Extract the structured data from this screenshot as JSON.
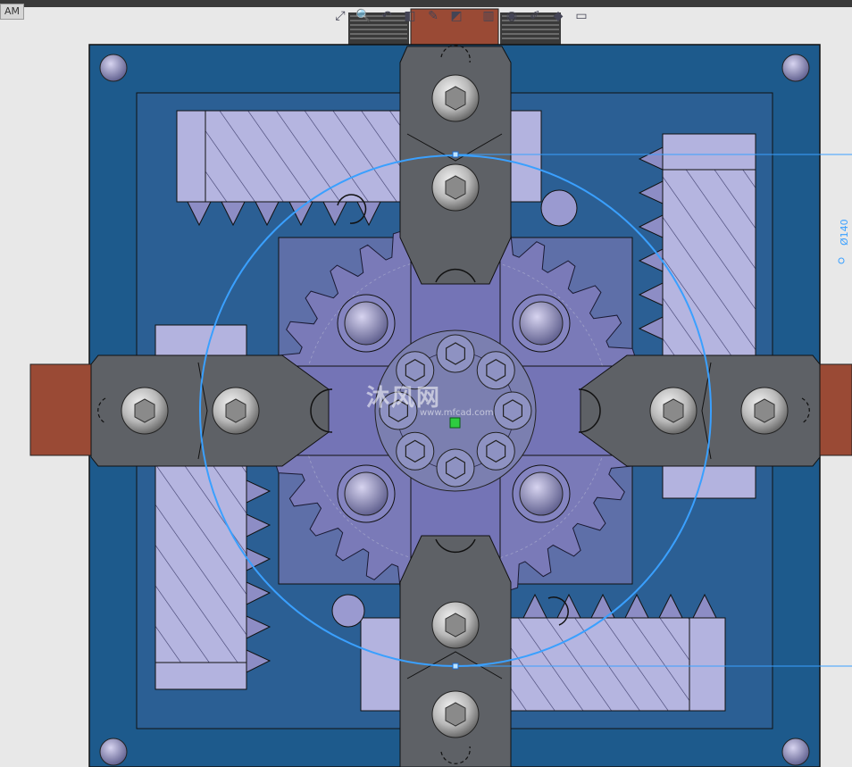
{
  "window": {
    "tab_label": "AM"
  },
  "toolbar": {
    "icons": [
      "zoom-fit-icon",
      "zoom-area-icon",
      "previous-view-icon",
      "section-view-icon",
      "dynamic-annotation-icon",
      "view-orientation-icon",
      "display-style-icon",
      "hide-show-icon",
      "edit-appearance-icon",
      "apply-scene-icon",
      "view-settings-icon"
    ]
  },
  "watermark": {
    "text": "沐风网",
    "sub": "www.mfcad.com"
  },
  "dimension": {
    "text": "Ø140"
  },
  "colors": {
    "plate": "#1d5a8c",
    "inner_plate": "#2b5f94",
    "part_lavender": "#b3b3df",
    "gear": "#7a7ab8",
    "clamp_gray": "#5e6166",
    "copper": "#9a4a35",
    "sketch_blue": "#3aa0ff"
  }
}
